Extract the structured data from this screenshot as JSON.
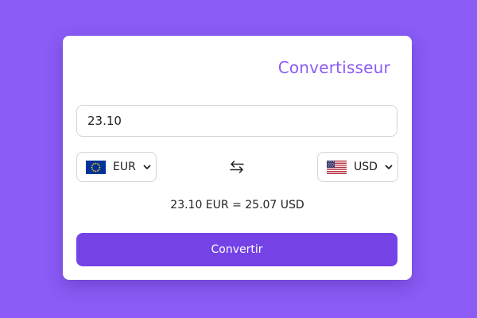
{
  "converter": {
    "title": "Convertisseur",
    "amount_value": "23.10",
    "from": {
      "code": "EUR",
      "flag": "eu-flag"
    },
    "to": {
      "code": "USD",
      "flag": "us-flag"
    },
    "swap_icon": "swap-arrows-icon",
    "result_text": "23.10 EUR = 25.07 USD",
    "convert_label": "Convertir"
  },
  "colors": {
    "background": "#8b5cf6",
    "title": "#8b5cf6",
    "button": "#7542e6",
    "card": "#ffffff"
  }
}
